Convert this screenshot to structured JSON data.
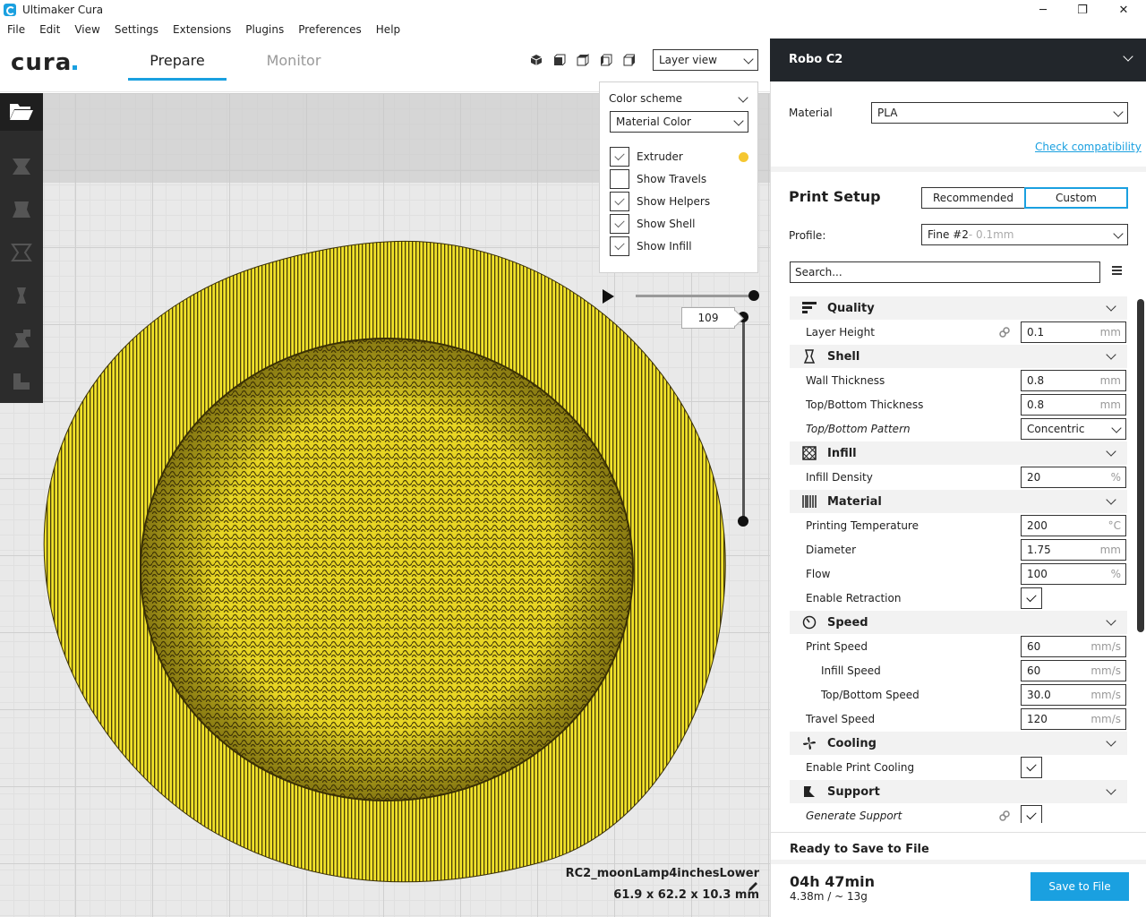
{
  "window": {
    "title": "Ultimaker Cura",
    "controls": {
      "minimize": "─",
      "maximize": "❐",
      "close": "✕"
    }
  },
  "menu": [
    "File",
    "Edit",
    "View",
    "Settings",
    "Extensions",
    "Plugins",
    "Preferences",
    "Help"
  ],
  "header": {
    "logo_text": "cura",
    "tabs": [
      {
        "label": "Prepare",
        "active": true
      },
      {
        "label": "Monitor",
        "active": false
      }
    ],
    "view_mode": "Layer view",
    "view_icons": [
      "3d-view-icon",
      "front-view-icon",
      "top-view-icon",
      "left-view-icon",
      "right-view-icon"
    ]
  },
  "tool_sidebar": [
    "open-file-icon",
    "move-tool-icon",
    "scale-tool-icon",
    "rotate-tool-icon",
    "mirror-tool-icon",
    "per-model-settings-icon",
    "support-blocker-icon"
  ],
  "layer_panel": {
    "color_scheme_label": "Color scheme",
    "color_scheme_value": "Material Color",
    "options": [
      {
        "label": "Extruder",
        "checked": true
      },
      {
        "label": "Show Travels",
        "checked": false
      },
      {
        "label": "Show Helpers",
        "checked": true
      },
      {
        "label": "Show Shell",
        "checked": true
      },
      {
        "label": "Show Infill",
        "checked": true
      }
    ],
    "extruder_color": "#f5c731",
    "current_layer": "109"
  },
  "model": {
    "name": "RC2_moonLamp4inchesLower",
    "dimensions": "61.9 x 62.2 x 10.3 mm",
    "color": "#f0e22a"
  },
  "sidebar": {
    "printer_name": "Robo C2",
    "material_label": "Material",
    "material_value": "PLA",
    "check_compat": "Check compatibility",
    "print_setup_label": "Print Setup",
    "mode_recommended": "Recommended",
    "mode_custom": "Custom",
    "profile_label": "Profile:",
    "profile_value": "Fine #2",
    "profile_layer": " - 0.1mm",
    "search_placeholder": "Search...",
    "categories": {
      "quality": "Quality",
      "shell": "Shell",
      "infill": "Infill",
      "material": "Material",
      "speed": "Speed",
      "cooling": "Cooling",
      "support": "Support"
    },
    "settings": {
      "layer_height": {
        "label": "Layer Height",
        "value": "0.1",
        "unit": "mm"
      },
      "wall_thickness": {
        "label": "Wall Thickness",
        "value": "0.8",
        "unit": "mm"
      },
      "top_bottom_thickness": {
        "label": "Top/Bottom Thickness",
        "value": "0.8",
        "unit": "mm"
      },
      "top_bottom_pattern": {
        "label": "Top/Bottom Pattern",
        "value": "Concentric"
      },
      "infill_density": {
        "label": "Infill Density",
        "value": "20",
        "unit": "%"
      },
      "printing_temperature": {
        "label": "Printing Temperature",
        "value": "200",
        "unit": "°C"
      },
      "diameter": {
        "label": "Diameter",
        "value": "1.75",
        "unit": "mm"
      },
      "flow": {
        "label": "Flow",
        "value": "100",
        "unit": "%"
      },
      "enable_retraction": {
        "label": "Enable Retraction",
        "checked": true
      },
      "print_speed": {
        "label": "Print Speed",
        "value": "60",
        "unit": "mm/s"
      },
      "infill_speed": {
        "label": "Infill Speed",
        "value": "60",
        "unit": "mm/s"
      },
      "top_bottom_speed": {
        "label": "Top/Bottom Speed",
        "value": "30.0",
        "unit": "mm/s"
      },
      "travel_speed": {
        "label": "Travel Speed",
        "value": "120",
        "unit": "mm/s"
      },
      "enable_print_cooling": {
        "label": "Enable Print Cooling",
        "checked": true
      },
      "generate_support": {
        "label": "Generate Support",
        "checked": true
      }
    },
    "save": {
      "ready_label": "Ready to Save to File",
      "time": "04h 47min",
      "usage": "4.38m / ~ 13g",
      "button": "Save to File"
    }
  },
  "colors": {
    "accent": "#1aa0e0",
    "dark": "#22262b",
    "tool_sidebar": "#2c2c2c"
  }
}
